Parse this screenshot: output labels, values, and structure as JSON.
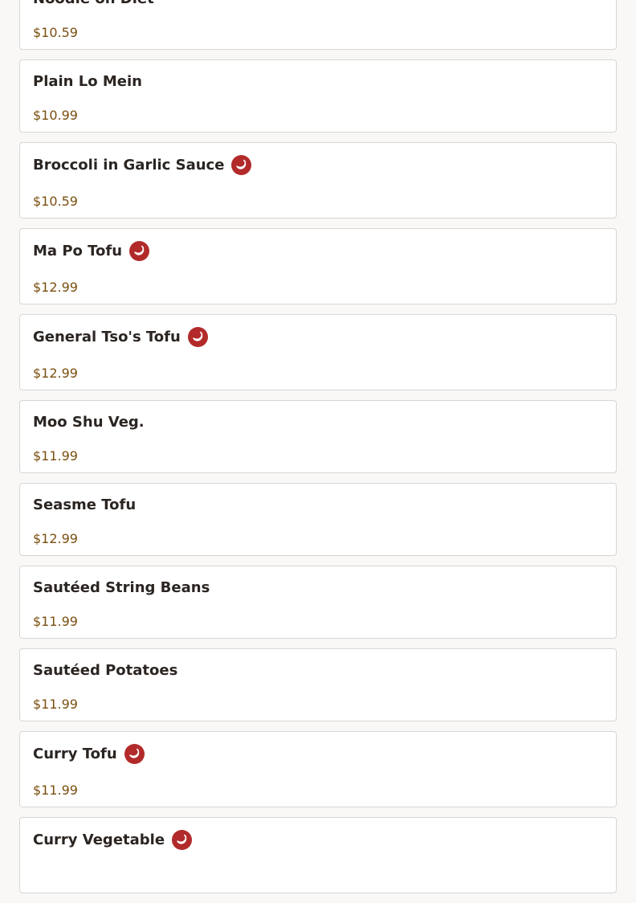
{
  "spicy_icon": "chili-pepper-icon",
  "colors": {
    "spicy": "#b22a2a",
    "price": "#7a4f0f",
    "name": "#2b2522",
    "border": "#d8d6d4"
  },
  "menu": {
    "items": [
      {
        "name": "Noodle on Diet",
        "price": "$10.59",
        "spicy": false
      },
      {
        "name": "Plain Lo Mein",
        "price": "$10.99",
        "spicy": false
      },
      {
        "name": "Broccoli in Garlic Sauce",
        "price": "$10.59",
        "spicy": true
      },
      {
        "name": "Ma Po Tofu",
        "price": "$12.99",
        "spicy": true
      },
      {
        "name": "General Tso's Tofu",
        "price": "$12.99",
        "spicy": true
      },
      {
        "name": "Moo Shu Veg.",
        "price": "$11.99",
        "spicy": false
      },
      {
        "name": "Seasme Tofu",
        "price": "$12.99",
        "spicy": false
      },
      {
        "name": "Sautéed String Beans",
        "price": "$11.99",
        "spicy": false
      },
      {
        "name": "Sautéed Potatoes",
        "price": "$11.99",
        "spicy": false
      },
      {
        "name": "Curry Tofu",
        "price": "$11.99",
        "spicy": true
      },
      {
        "name": "Curry Vegetable",
        "price": "",
        "spicy": true
      }
    ]
  }
}
